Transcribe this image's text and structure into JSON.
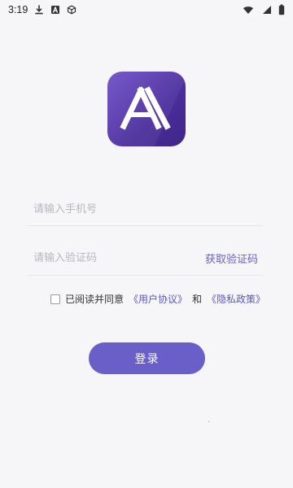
{
  "status_bar": {
    "time": "3:19",
    "icons_left": [
      "download-icon",
      "font-a-icon",
      "cube-icon"
    ],
    "icons_right": [
      "wifi-icon",
      "signal-icon",
      "battery-icon"
    ]
  },
  "app": {
    "logo_icon": "app-logo-a-icon",
    "brand_gradient": [
      "#6f4fc8",
      "#3f2588"
    ],
    "accent_color": "#6a5fc8"
  },
  "form": {
    "phone_placeholder": "请输入手机号",
    "code_placeholder": "请输入验证码",
    "get_code_label": "获取验证码"
  },
  "agreement": {
    "prefix": "已阅读并同意",
    "terms_link": "《用户协议》",
    "connector": "和",
    "privacy_link": "《隐私政策》"
  },
  "login": {
    "label": "登录"
  }
}
